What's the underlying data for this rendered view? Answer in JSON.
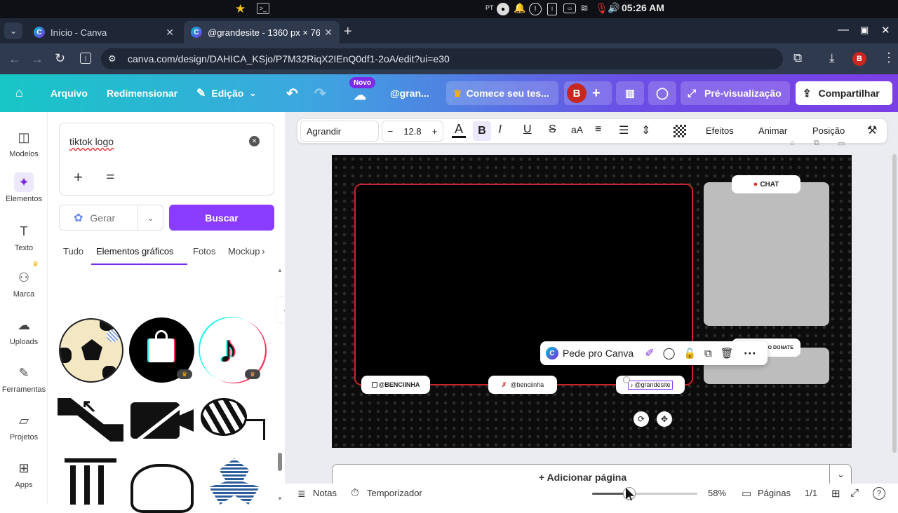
{
  "os": {
    "clock": "05:26 AM",
    "indicator_pt": "PT"
  },
  "tabs": [
    {
      "title": "Início - Canva",
      "active": false
    },
    {
      "title": "@grandesite - 1360 px × 768",
      "active": true
    }
  ],
  "address": {
    "url": "canva.com/design/DAHICA_KSjo/P7M32RiqX2IEnQ0df1-2oA/edit?ui=e30",
    "profile_initial": "B"
  },
  "header": {
    "menu_file": "Arquivo",
    "menu_resize": "Redimensionar",
    "menu_edit": "Edição",
    "new_badge": "Novo",
    "design_name": "@gran...",
    "trial": "Comece seu tes...",
    "avatar_initial": "B",
    "preview": "Pré-visualização",
    "share": "Compartilhar"
  },
  "rail": [
    {
      "label": "Modelos",
      "icon": "templates-icon"
    },
    {
      "label": "Elementos",
      "icon": "elements-icon"
    },
    {
      "label": "Texto",
      "icon": "text-icon"
    },
    {
      "label": "Marca",
      "icon": "brand-icon"
    },
    {
      "label": "Uploads",
      "icon": "upload-icon"
    },
    {
      "label": "Ferramentas",
      "icon": "tools-icon"
    },
    {
      "label": "Projetos",
      "icon": "folder-icon"
    },
    {
      "label": "Apps",
      "icon": "apps-icon"
    }
  ],
  "panel": {
    "search_value": "tiktok logo",
    "generate": "Gerar",
    "search_button": "Buscar",
    "filters": [
      "Tudo",
      "Elementos gráficos",
      "Fotos",
      "Mockup"
    ]
  },
  "toolbar": {
    "font": "Agrandir",
    "font_size": "12.8",
    "effects": "Efeitos",
    "animate": "Animar",
    "position": "Posição"
  },
  "canvas": {
    "chat_label": "CHAT",
    "donate_label": "O DONATE",
    "handle_1": "@BENCIINHA",
    "handle_2": "@benciinha",
    "handle_3": "@grandesite",
    "ask_canva": "Pede pro Canva"
  },
  "footer": {
    "add_page": "+ Adicionar página",
    "notes": "Notas",
    "timer": "Temporizador",
    "zoom": "58%",
    "zoom_level": 0.35,
    "pages": "Páginas",
    "page_count": "1/1"
  },
  "colors": {
    "accent": "#7d2ae8",
    "frame_red": "#c8242c",
    "header_start": "#17c6c6",
    "header_end": "#7b3fe6"
  }
}
